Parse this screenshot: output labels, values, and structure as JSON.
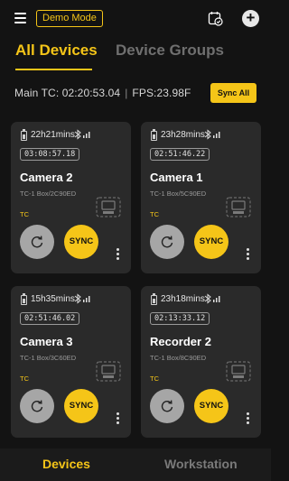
{
  "header": {
    "mode_label": "Demo Mode",
    "icons": [
      "menu-icon",
      "check-schedule-icon",
      "add-icon"
    ]
  },
  "tabs": [
    {
      "label": "All Devices",
      "active": true
    },
    {
      "label": "Device Groups",
      "active": false
    }
  ],
  "timecode": {
    "main_tc": "Main TC: 02:20:53.04",
    "separator": "|",
    "fps": "FPS:23.98F",
    "sync_all_label": "Sync All"
  },
  "devices": [
    {
      "runtime": "22h21mins",
      "tc": "03:08:57.18",
      "name": "Camera 2",
      "model": "TC-1 Box/2C90ED",
      "tag": "TC",
      "sync_label": "SYNC"
    },
    {
      "runtime": "23h28mins",
      "tc": "02:51:46.22",
      "name": "Camera 1",
      "model": "TC-1 Box/5C90ED",
      "tag": "TC",
      "sync_label": "SYNC"
    },
    {
      "runtime": "15h35mins",
      "tc": "02:51:46.02",
      "name": "Camera 3",
      "model": "TC-1 Box/3C60ED",
      "tag": "TC",
      "sync_label": "SYNC"
    },
    {
      "runtime": "23h18mins",
      "tc": "02:13:33.12",
      "name": "Recorder 2",
      "model": "TC-1 Box/8C90ED",
      "tag": "TC",
      "sync_label": "SYNC"
    }
  ],
  "bottom_nav": [
    {
      "label": "Devices",
      "active": true
    },
    {
      "label": "Workstation",
      "active": false
    }
  ],
  "colors": {
    "accent": "#f5c518",
    "background": "#131313",
    "card": "#2a2a2a"
  }
}
